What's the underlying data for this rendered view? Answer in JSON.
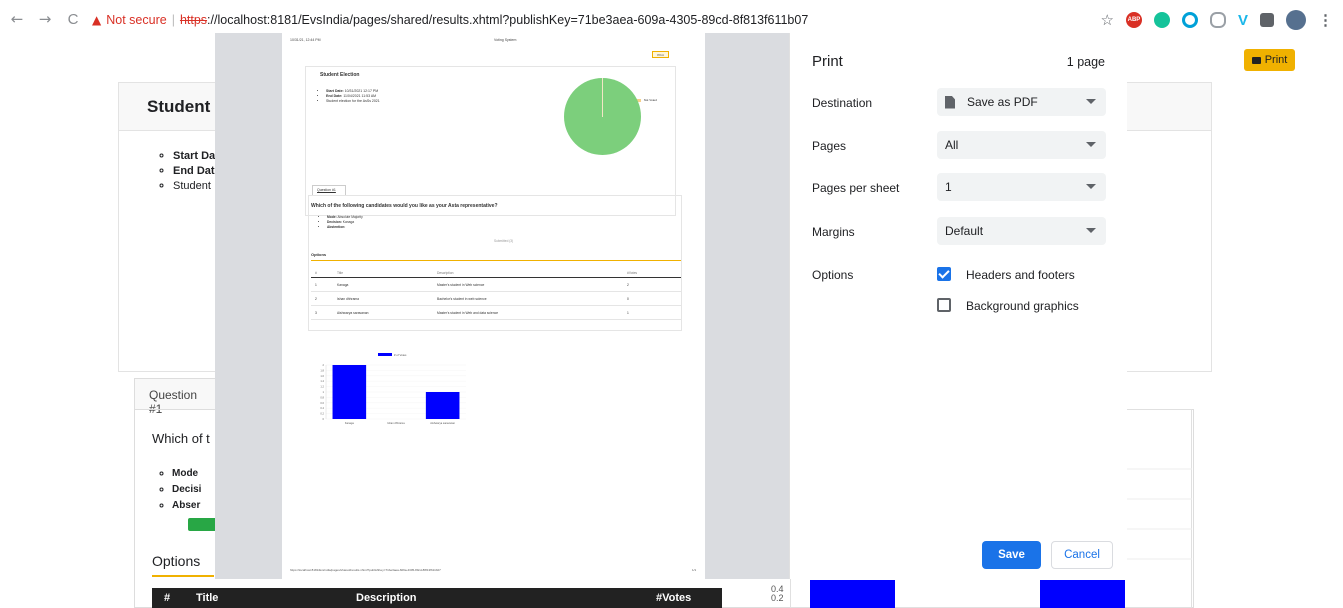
{
  "browser": {
    "back_icon": "←",
    "forward_icon": "→",
    "reload_icon": "C",
    "not_secure": "Not secure",
    "url_proto": "https",
    "url_rest": "://localhost:8181/EvsIndia/pages/shared/results.xhtml?publishKey=71be3aea-609a-4305-89cd-8f813f611b07",
    "star_icon": "☆",
    "abp_label": "ABP"
  },
  "background": {
    "print_label": "Print",
    "card_title": "Student",
    "list": [
      "Start Date",
      "End Date:",
      "Student"
    ],
    "question_tab": "Question #1",
    "question_text": "Which of t",
    "q_list": [
      "Mode",
      "Decisi",
      "Abser"
    ],
    "options_heading": "Options",
    "table_headers": [
      "#",
      "Title",
      "Description",
      "#Votes"
    ],
    "axis_ticks": [
      "0.4",
      "0.2"
    ]
  },
  "preview": {
    "header_left": "10/31/21, 12:44 PM",
    "header_center": "Voting System",
    "print_label": "Print",
    "title": "Student Election",
    "details": [
      {
        "label": "Start Date:",
        "value": "10/31/2021 12:17 PM"
      },
      {
        "label": "End Date:",
        "value": "11/04/2021 11:53 AM"
      },
      {
        "label": "",
        "value": "Student election for the AsSs 2021"
      }
    ],
    "legend": [
      "Voted",
      "Not Voted"
    ],
    "tab": "Question #1",
    "question": "Which of the following candidates would you like as your Asta representative?",
    "q_details": [
      {
        "label": "Mode:",
        "value": "Absolute Majority"
      },
      {
        "label": "Decision:",
        "value": "Kanaga"
      },
      {
        "label": "Abstention:",
        "value": ""
      }
    ],
    "submitted": "Submitted (3)",
    "options_heading": "Options",
    "table_headers": [
      "#",
      "Title",
      "Description",
      "#Votes"
    ],
    "rows": [
      [
        "1",
        "Kanaga",
        "Master's student in Web science",
        "2"
      ],
      [
        "2",
        "Ishan dhhrama",
        "Bachelor's student in web science",
        "0"
      ],
      [
        "3",
        "Aishwarya saravanan",
        "Master's student in Web and data science",
        "1"
      ]
    ],
    "footer_url": "https://localhost:8181/EvsIndia/pages/shared/results.xhtml?publishKey=71be3aea-609a-4305-89cd-8f813f611b07",
    "footer_page": "1/1"
  },
  "chart_data": {
    "type": "bar",
    "categories": [
      "Kanaga",
      "Ishan dhhrama",
      "Aishwarya saravanan"
    ],
    "series": [
      {
        "name": "# of Votes",
        "values": [
          2,
          0,
          1
        ]
      }
    ],
    "y_ticks": [
      "2",
      "1.8",
      "1.6",
      "1.4",
      "1.2",
      "1",
      "0.8",
      "0.6",
      "0.4",
      "0.2",
      "0"
    ],
    "ylim": [
      0,
      2
    ]
  },
  "dialog": {
    "title": "Print",
    "page_count": "1 page",
    "destination_label": "Destination",
    "destination_value": "Save as PDF",
    "pages_label": "Pages",
    "pages_value": "All",
    "pps_label": "Pages per sheet",
    "pps_value": "1",
    "margins_label": "Margins",
    "margins_value": "Default",
    "options_label": "Options",
    "headers_footers": "Headers and footers",
    "headers_footers_checked": true,
    "background_graphics": "Background graphics",
    "background_graphics_checked": false,
    "save_label": "Save",
    "cancel_label": "Cancel"
  }
}
